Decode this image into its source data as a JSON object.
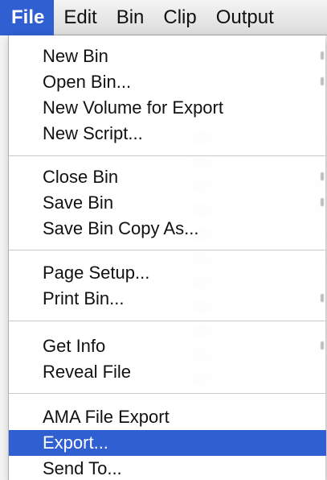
{
  "menubar": {
    "items": [
      "File",
      "Edit",
      "Bin",
      "Clip",
      "Output"
    ],
    "active_index": 0
  },
  "file_menu": {
    "groups": [
      [
        "New Bin",
        "Open Bin...",
        "New Volume for Export",
        "New Script..."
      ],
      [
        "Close Bin",
        "Save Bin",
        "Save Bin Copy As..."
      ],
      [
        "Page Setup...",
        "Print Bin..."
      ],
      [
        "Get Info",
        "Reveal File"
      ],
      [
        "AMA File Export",
        "Export...",
        "Send To..."
      ]
    ],
    "highlighted_item": "Export..."
  },
  "colors": {
    "highlight": "#2f5fd0",
    "highlight_text": "#ffffff",
    "menu_text": "#111111"
  }
}
